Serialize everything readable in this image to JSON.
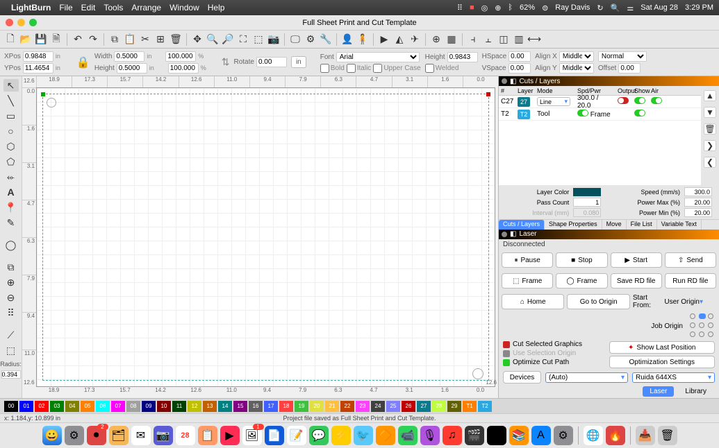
{
  "menubar": {
    "app": "LightBurn",
    "items": [
      "File",
      "Edit",
      "Tools",
      "Arrange",
      "Window",
      "Help"
    ],
    "right": {
      "user": "Ray Davis",
      "battery": "62%",
      "date": "Sat Aug 28",
      "time": "3:29 PM"
    }
  },
  "window_title": "Full Sheet Print and Cut Template",
  "props": {
    "xpos_label": "XPos",
    "xpos": "0.9848",
    "ypos_label": "YPos",
    "ypos": "11.4654",
    "width_label": "Width",
    "width": "0.5000",
    "width_pct": "100.000",
    "height_label": "Height",
    "height": "0.5000",
    "height_pct": "100.000",
    "rotate_label": "Rotate",
    "rotate": "0.00",
    "unit_in": "in",
    "unit_pct": "%",
    "font_label": "Font",
    "font": "Arial",
    "height2_label": "Height",
    "height2": "0.9843",
    "hspace_label": "HSpace",
    "hspace": "0.00",
    "vspace_label": "VSpace",
    "vspace": "0.00",
    "alignx_label": "Align X",
    "alignx": "Middle",
    "aligny_label": "Align Y",
    "aligny": "Middle",
    "style_label": "Normal",
    "offset_label": "Offset",
    "offset": "0.00",
    "bold": "Bold",
    "italic": "Italic",
    "upper": "Upper Case",
    "welded": "Welded"
  },
  "ruler_h": [
    "18.9",
    "17.3",
    "15.7",
    "14.2",
    "12.6",
    "11.0",
    "9.4",
    "7.9",
    "6.3",
    "4.7",
    "3.1",
    "1.6",
    "0.0"
  ],
  "ruler_v": [
    "0.0",
    "1.6",
    "3.1",
    "4.7",
    "6.3",
    "7.9",
    "9.4",
    "11.0"
  ],
  "ruler_corner_tl": "12.6",
  "ruler_corner_tr": "12.6",
  "cuts_panel": {
    "title": "Cuts / Layers",
    "headers": [
      "#",
      "Layer",
      "Mode",
      "Spd/Pwr",
      "Output",
      "Show",
      "Air"
    ],
    "rows": [
      {
        "n": "C27",
        "layer_num": "27",
        "layer_color": "#0a7a8c",
        "mode": "Line",
        "spdpwr": "300.0 / 20.0",
        "output": "off",
        "show": "on",
        "air": "on"
      },
      {
        "n": "T2",
        "layer_num": "T2",
        "layer_color": "#2aa8e0",
        "mode": "Tool",
        "spdpwr": "",
        "frame": "Frame",
        "output": "on",
        "show": "on",
        "air": ""
      }
    ],
    "layer_color_label": "Layer Color",
    "pass_count_label": "Pass Count",
    "pass_count": "1",
    "interval_label": "Interval (mm)",
    "interval": "0.080",
    "speed_label": "Speed (mm/s)",
    "speed": "300.0",
    "pmax_label": "Power Max (%)",
    "pmax": "20.00",
    "pmin_label": "Power Min (%)",
    "pmin": "20.00",
    "tabs": [
      "Cuts / Layers",
      "Shape Properties",
      "Move",
      "File List",
      "Variable Text"
    ]
  },
  "laser_panel": {
    "title": "Laser",
    "status": "Disconnected",
    "pause": "Pause",
    "stop": "Stop",
    "start": "Start",
    "send": "Send",
    "frame": "Frame",
    "frame2": "Frame",
    "save_rd": "Save RD file",
    "run_rd": "Run RD file",
    "home": "Home",
    "goto_origin": "Go to Origin",
    "start_from_label": "Start From:",
    "start_from": "User Origin",
    "job_origin_label": "Job Origin",
    "cut_sel": "Cut Selected Graphics",
    "use_sel": "Use Selection Origin",
    "opt_path": "Optimize Cut Path",
    "show_last": "Show Last Position",
    "opt_settings": "Optimization Settings",
    "devices": "Devices",
    "device_auto": "(Auto)",
    "controller": "Ruida 644XS"
  },
  "bottom_tabs": {
    "laser": "Laser",
    "library": "Library"
  },
  "left_tools": {
    "radius_label": "Radius:",
    "radius": "0.394"
  },
  "colors": [
    {
      "n": "00",
      "c": "#000000"
    },
    {
      "n": "01",
      "c": "#0000ff"
    },
    {
      "n": "02",
      "c": "#ff0000"
    },
    {
      "n": "03",
      "c": "#008000"
    },
    {
      "n": "04",
      "c": "#808000"
    },
    {
      "n": "05",
      "c": "#ff8000"
    },
    {
      "n": "06",
      "c": "#00ffff"
    },
    {
      "n": "07",
      "c": "#ff00ff"
    },
    {
      "n": "08",
      "c": "#a0a0a0"
    },
    {
      "n": "09",
      "c": "#000080"
    },
    {
      "n": "10",
      "c": "#800000"
    },
    {
      "n": "11",
      "c": "#004000"
    },
    {
      "n": "12",
      "c": "#c0c000"
    },
    {
      "n": "13",
      "c": "#c06000"
    },
    {
      "n": "14",
      "c": "#008080"
    },
    {
      "n": "15",
      "c": "#800080"
    },
    {
      "n": "16",
      "c": "#606060"
    },
    {
      "n": "17",
      "c": "#4060ff"
    },
    {
      "n": "18",
      "c": "#ff4040"
    },
    {
      "n": "19",
      "c": "#40c040"
    },
    {
      "n": "20",
      "c": "#e0e040"
    },
    {
      "n": "21",
      "c": "#ffc040"
    },
    {
      "n": "22",
      "c": "#c04000"
    },
    {
      "n": "23",
      "c": "#ff40ff"
    },
    {
      "n": "24",
      "c": "#404040"
    },
    {
      "n": "25",
      "c": "#8080ff"
    },
    {
      "n": "26",
      "c": "#c00000"
    },
    {
      "n": "27",
      "c": "#0a7a8c"
    },
    {
      "n": "28",
      "c": "#c0ff40"
    },
    {
      "n": "29",
      "c": "#606000"
    },
    {
      "n": "T1",
      "c": "#ff8000"
    },
    {
      "n": "T2",
      "c": "#2aa8e0"
    }
  ],
  "status": {
    "coords": "x: 1.184,y: 10.899 in",
    "msg": "Project file saved as Full Sheet Print and Cut Template."
  }
}
